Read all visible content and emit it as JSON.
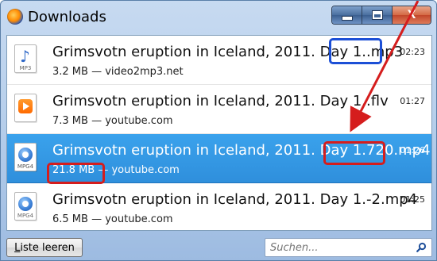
{
  "window": {
    "title": "Downloads",
    "controls": {
      "minimize": "minimize",
      "maximize": "maximize",
      "close": "X"
    }
  },
  "downloads": [
    {
      "filename": "Grimsvotn eruption in Iceland, 2011. Day 1..mp3",
      "meta": "3.2 MB — video2mp3.net",
      "time": "02:23",
      "icon": "mp3-file-icon",
      "icon_tag": "MP3"
    },
    {
      "filename": "Grimsvotn eruption in Iceland, 2011. Day 1..flv",
      "meta": "7.3 MB — youtube.com",
      "time": "01:27",
      "icon": "flv-file-icon",
      "icon_tag": ""
    },
    {
      "filename": "Grimsvotn eruption in Iceland, 2011. Day 1.720.mp4",
      "meta": "21.8 MB — youtube.com",
      "time": "01:26",
      "icon": "mp4-file-icon",
      "icon_tag": "MPG4",
      "selected": true
    },
    {
      "filename": "Grimsvotn eruption in Iceland, 2011. Day 1.-2.mp4",
      "meta": "6.5 MB — youtube.com",
      "time": "01:25",
      "icon": "mp4-file-icon",
      "icon_tag": "MPG4"
    }
  ],
  "bottom": {
    "clear_list_label_prefix": "L",
    "clear_list_label_rest": "iste leeren",
    "search_placeholder": "Suchen...",
    "search_value": ""
  },
  "annotations": {
    "blue": "#1c4fd6",
    "red": "#d51d1d"
  },
  "colors": {
    "selection": "#2f8fdc",
    "title_bar": "#b7cfeb"
  }
}
